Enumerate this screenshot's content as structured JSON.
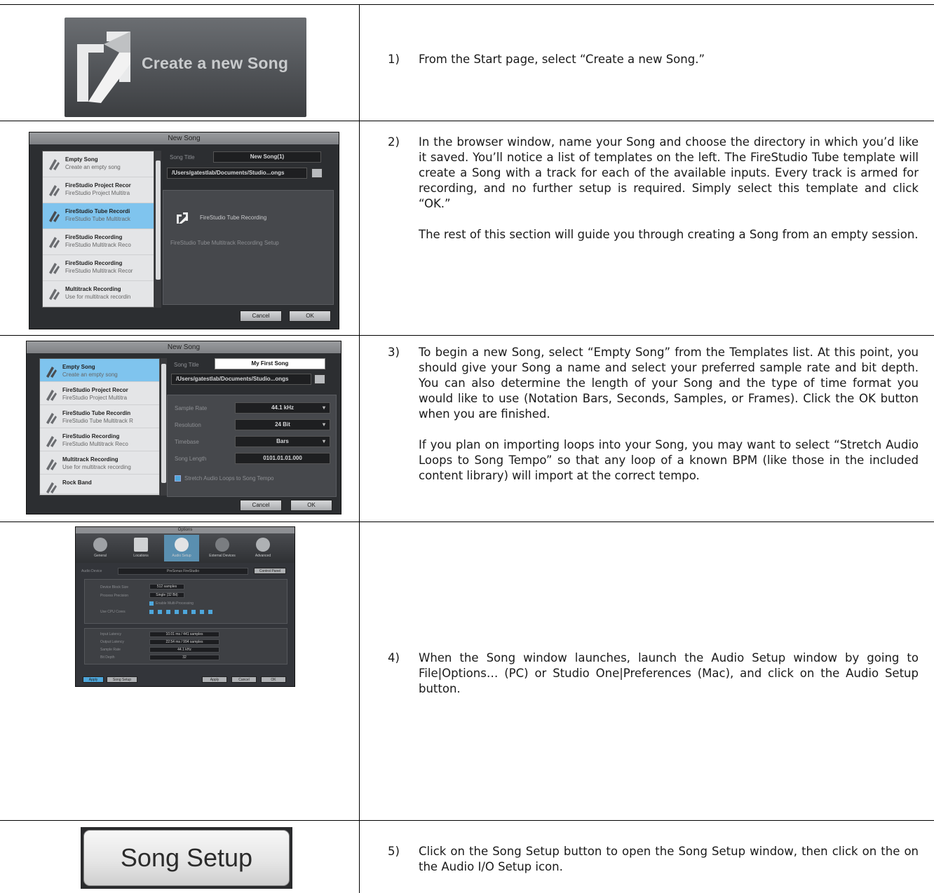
{
  "rows": [
    {
      "num": "1)",
      "paragraphs": [
        "From the Start page, select “Create a new Song.”"
      ]
    },
    {
      "num": "2)",
      "paragraphs": [
        "In the browser window, name your Song and choose the directory in which you’d like it saved. You’ll notice a list of templates on the left. The FireStudio Tube template will create a Song with a track for each of the available inputs. Every track is armed for recording, and no further setup is required. Simply select this template and click “OK.”",
        "The rest of this section will guide you through creating a Song from an empty session."
      ]
    },
    {
      "num": "3)",
      "paragraphs": [
        "To begin a new Song, select “Empty Song” from the Templates list. At this point, you should give your Song a name and select your preferred sample rate and bit depth. You can also determine the length of your Song and the type of time format you would like to use (Notation Bars, Seconds, Samples, or Frames). Click the OK button when you are finished.",
        "If you plan on importing loops into your Song, you may want to select “Stretch Audio Loops to Song Tempo” so that any loop of a known BPM (like those in the included content library) will import at the correct tempo."
      ]
    },
    {
      "num": "4)",
      "paragraphs": [
        "When the Song window launches, launch the Audio Setup window by going to File|Options… (PC) or Studio One|Preferences (Mac), and click on the Audio Setup button."
      ]
    },
    {
      "num": "5)",
      "paragraphs": [
        "Click on the Song Setup button to open the Song Setup window, then click on the on the Audio I/O Setup icon."
      ]
    }
  ],
  "banner": {
    "label": "Create a new Song"
  },
  "dialog1": {
    "title": "New Song",
    "templates": [
      {
        "title": "Empty Song",
        "sub": "Create an empty song"
      },
      {
        "title": "FireStudio Project Recor",
        "sub": "FireStudio Project Multitra"
      },
      {
        "title": "FireStudio Tube Recordi",
        "sub": "FireStudio Tube Multitrack"
      },
      {
        "title": "FireStudio Recording",
        "sub": "FireStudio Multitrack Reco"
      },
      {
        "title": "FireStudio Recording",
        "sub": "FireStudio Multitrack Recor"
      },
      {
        "title": "Multitrack Recording",
        "sub": "Use for multitrack recordin"
      }
    ],
    "song_title_label": "Song Title",
    "song_title_value": "New Song(1)",
    "path": "/Users/gatestlab/Documents/Studio...ongs",
    "template_name": "FireStudio Tube Recording",
    "template_desc": "FireStudio Tube Multitrack Recording Setup",
    "cancel": "Cancel",
    "ok": "OK"
  },
  "dialog2": {
    "title": "New Song",
    "templates": [
      {
        "title": "Empty Song",
        "sub": "Create an empty song"
      },
      {
        "title": "FireStudio Project Recor",
        "sub": "FireStudio Project Multitra"
      },
      {
        "title": "FireStudio Tube Recordin",
        "sub": "FireStudio Tube Multitrack R"
      },
      {
        "title": "FireStudio Recording",
        "sub": "FireStudio Multitrack Reco"
      },
      {
        "title": "Multitrack Recording",
        "sub": "Use for multitrack recording"
      },
      {
        "title": "Rock Band",
        "sub": ""
      }
    ],
    "song_title_label": "Song Title",
    "song_title_value": "My First Song",
    "path": "/Users/gatestlab/Documents/Studio...ongs",
    "sample_rate_label": "Sample Rate",
    "sample_rate": "44.1 kHz",
    "resolution_label": "Resolution",
    "resolution": "24 Bit",
    "timebase_label": "Timebase",
    "timebase": "Bars",
    "length_label": "Song Length",
    "length": "0101.01.01.000",
    "stretch": "Stretch Audio Loops to Song Tempo",
    "cancel": "Cancel",
    "ok": "OK"
  },
  "options": {
    "title": "Options",
    "tools": [
      "General",
      "Locations",
      "Audio Setup",
      "External Devices",
      "Advanced"
    ],
    "device_label": "Audio Device",
    "device": "PreSonus FireStudio",
    "control_panel": "Control Panel",
    "block_label": "Device Block Size",
    "block": "512 samples",
    "process_label": "Process Precision",
    "process": "Single (32 Bit)",
    "multi": "Enable Multi-Processing",
    "cpus_label": "Use CPU Cores",
    "in_label": "Input Latency",
    "in": "10.01 ms / 441 samples",
    "out_label": "Output Latency",
    "out": "22.54 ms / 994 samples",
    "rate_label": "Sample Rate",
    "rate": "44.1 kHz",
    "bit_label": "Bit Depth",
    "bit": "32",
    "b_apply_left": "Apply",
    "b_song": "Song Setup",
    "b_apply": "Apply",
    "b_cancel": "Cancel",
    "b_ok": "OK"
  },
  "song_setup": {
    "label": "Song Setup"
  },
  "colors": {
    "rule": "#000000",
    "selection": "#7fc4ee",
    "accent": "#4ea7dc"
  }
}
